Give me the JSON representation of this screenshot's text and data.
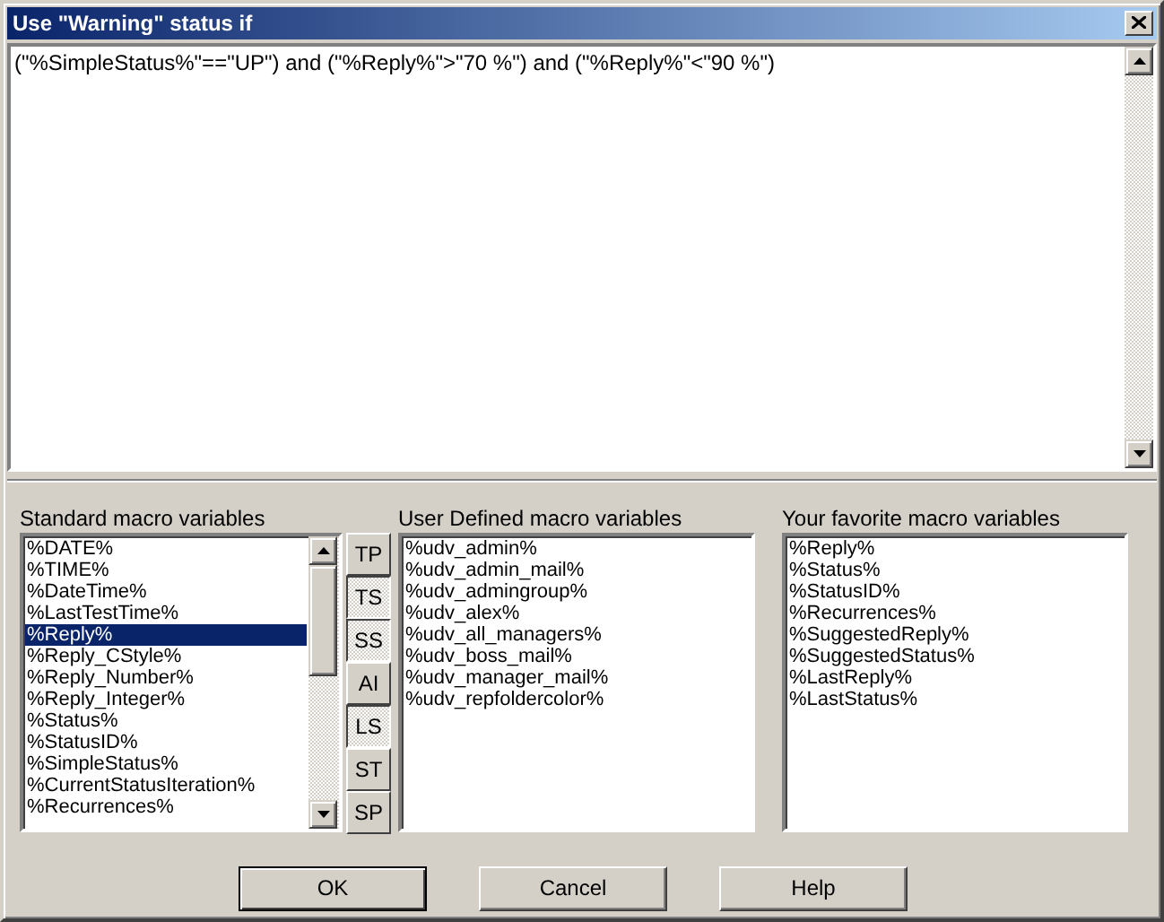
{
  "window": {
    "title": "Use \"Warning\" status if"
  },
  "expression": {
    "value": "(\"%SimpleStatus%\"==\"UP\") and (\"%Reply%\">\"70 %\") and (\"%Reply%\"<\"90 %\")"
  },
  "standard": {
    "label": "Standard macro variables",
    "items": [
      {
        "text": "%DATE%",
        "selected": false
      },
      {
        "text": "%TIME%",
        "selected": false
      },
      {
        "text": "%DateTime%",
        "selected": false
      },
      {
        "text": "%LastTestTime%",
        "selected": false
      },
      {
        "text": "%Reply%",
        "selected": true
      },
      {
        "text": "%Reply_CStyle%",
        "selected": false
      },
      {
        "text": "%Reply_Number%",
        "selected": false
      },
      {
        "text": "%Reply_Integer%",
        "selected": false
      },
      {
        "text": "%Status%",
        "selected": false
      },
      {
        "text": "%StatusID%",
        "selected": false
      },
      {
        "text": "%SimpleStatus%",
        "selected": false
      },
      {
        "text": "%CurrentStatusIteration%",
        "selected": false
      },
      {
        "text": "%Recurrences%",
        "selected": false
      }
    ]
  },
  "filters": [
    {
      "label": "TP",
      "pressed": false
    },
    {
      "label": "TS",
      "pressed": true
    },
    {
      "label": "SS",
      "pressed": true
    },
    {
      "label": "AI",
      "pressed": false
    },
    {
      "label": "LS",
      "pressed": true
    },
    {
      "label": "ST",
      "pressed": false
    },
    {
      "label": "SP",
      "pressed": false
    }
  ],
  "user_defined": {
    "label": "User Defined macro variables",
    "items": [
      "%udv_admin%",
      "%udv_admin_mail%",
      "%udv_admingroup%",
      "%udv_alex%",
      "%udv_all_managers%",
      "%udv_boss_mail%",
      "%udv_manager_mail%",
      "%udv_repfoldercolor%"
    ]
  },
  "favorites": {
    "label": "Your favorite macro variables",
    "items": [
      "%Reply%",
      "%Status%",
      "%StatusID%",
      "%Recurrences%",
      "%SuggestedReply%",
      "%SuggestedStatus%",
      "%LastReply%",
      "%LastStatus%"
    ]
  },
  "buttons": [
    {
      "label": "OK",
      "default": true
    },
    {
      "label": "Cancel",
      "default": false
    },
    {
      "label": "Help",
      "default": false
    }
  ]
}
